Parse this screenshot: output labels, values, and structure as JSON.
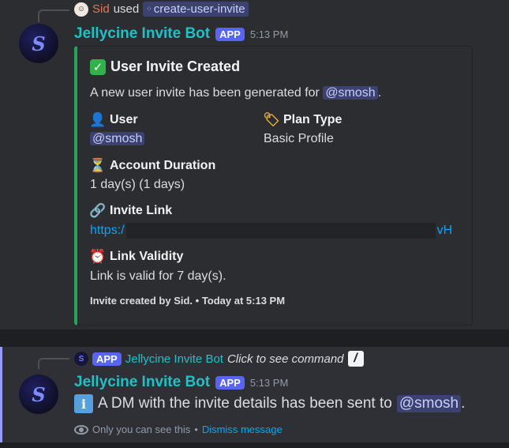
{
  "message1": {
    "reply": {
      "user": "Sid",
      "used_text": "used",
      "command": "create-user-invite"
    },
    "author": "Jellycine Invite Bot",
    "badge": "APP",
    "time": "5:13 PM",
    "embed": {
      "title": "User Invite Created",
      "desc_prefix": "A new user invite has been generated for",
      "desc_mention": "@smosh",
      "desc_suffix": ".",
      "fields": {
        "user": {
          "name": "User",
          "value": "@smosh",
          "icon": "user-silhouette-emoji"
        },
        "plan_type": {
          "name": "Plan Type",
          "value": "Basic Profile",
          "icon": "label-tag-emoji"
        },
        "account_duration": {
          "name": "Account Duration",
          "value": "1 day(s) (1 days)",
          "icon": "hourglass-emoji"
        },
        "invite_link": {
          "name": "Invite Link",
          "value_start": "https:/",
          "value_end": "vH",
          "icon": "link-emoji"
        },
        "link_validity": {
          "name": "Link Validity",
          "value": "Link is valid for 7 day(s).",
          "icon": "alarm-clock-emoji"
        }
      },
      "footer": "Invite created by Sid. • Today at 5:13 PM",
      "accent_color": "#23a55a"
    }
  },
  "message2": {
    "reply": {
      "badge": "APP",
      "bot": "Jellycine Invite Bot",
      "click_text": "Click to see command"
    },
    "author": "Jellycine Invite Bot",
    "badge": "APP",
    "time": "5:13 PM",
    "body_prefix": "A DM with the invite details has been sent to",
    "body_mention": "@smosh",
    "body_suffix": ".",
    "note": "Only you can see this",
    "note_sep": "•",
    "dismiss": "Dismiss message"
  },
  "colors": {
    "bot_name": "#1ec1c7",
    "app_badge": "#5865f2",
    "mention_bg": "#3c4270",
    "link": "#00a8fc"
  }
}
